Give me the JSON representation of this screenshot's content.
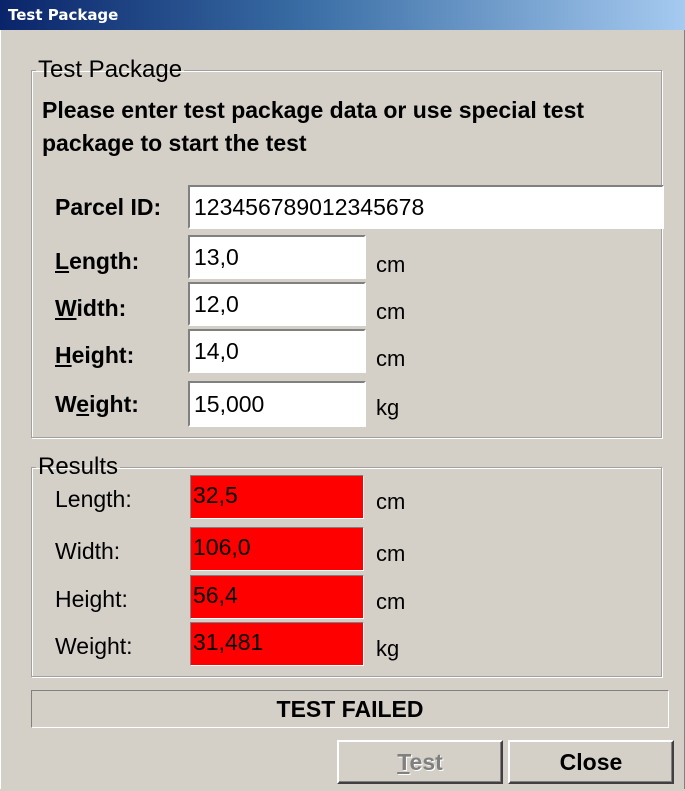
{
  "window": {
    "title": "Test Package"
  },
  "package_group": {
    "legend": "Test Package",
    "instruction": "Please enter test package data or use special test package to start the test",
    "parcel_id": {
      "label": "Parcel ID:",
      "value": "123456789012345678"
    },
    "length": {
      "mn": "L",
      "rest": "ength:",
      "value": "13,0",
      "unit": "cm"
    },
    "width": {
      "mn": "W",
      "rest": "idth:",
      "value": "12,0",
      "unit": "cm"
    },
    "height": {
      "mn": "H",
      "rest": "eight:",
      "value": "14,0",
      "unit": "cm"
    },
    "weight": {
      "pre": "W",
      "mn": "e",
      "rest": "ight:",
      "value": "15,000",
      "unit": "kg"
    }
  },
  "results_group": {
    "legend": "Results",
    "rows": [
      {
        "label": "Length:",
        "value": "32,5",
        "unit": "cm"
      },
      {
        "label": "Width:",
        "value": "106,0",
        "unit": "cm"
      },
      {
        "label": "Height:",
        "value": "56,4",
        "unit": "cm"
      },
      {
        "label": "Weight:",
        "value": "31,481",
        "unit": "kg"
      }
    ]
  },
  "status": {
    "text": "TEST FAILED"
  },
  "buttons": {
    "test": {
      "mn": "T",
      "rest": "est",
      "enabled": false
    },
    "close": {
      "label": "Close"
    }
  },
  "colors": {
    "fail_field": "#ff0000",
    "dialog_bg": "#d4d0c8",
    "title_bar": "#0a246a"
  }
}
